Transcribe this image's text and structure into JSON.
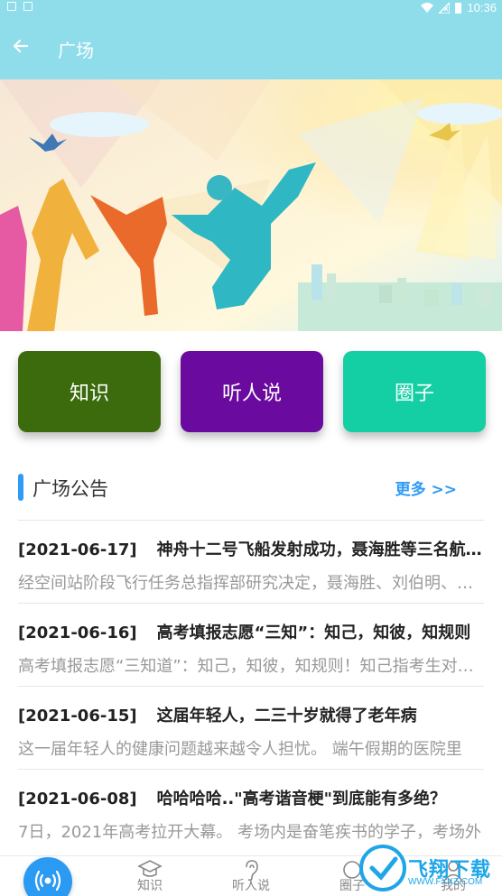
{
  "status_bar": {
    "time": "10:36"
  },
  "app_bar": {
    "title": "广场"
  },
  "categories": [
    {
      "label": "知识",
      "color": "#3b6b0d"
    },
    {
      "label": "听人说",
      "color": "#6a0a9f"
    },
    {
      "label": "圈子",
      "color": "#14cfa4"
    }
  ],
  "section": {
    "title": "广场公告",
    "more": "更多 >>"
  },
  "news": [
    {
      "date": "[2021-06-17]",
      "title": "神舟十二号飞船发射成功，聂海胜等三名航天员进入太空",
      "summary": "经空间站阶段飞行任务总指挥部研究决定，聂海胜、刘伯明、汤洪波三名航天员"
    },
    {
      "date": "[2021-06-16]",
      "title": "高考填报志愿“三知”：知己，知彼，知规则",
      "summary": "高考填报志愿“三知道”：知己，知彼，知规则！知己指考生对自己的了解"
    },
    {
      "date": "[2021-06-15]",
      "title": "这届年轻人，二三十岁就得了老年病",
      "summary": "这一届年轻人的健康问题越来越令人担忧。 端午假期的医院里"
    },
    {
      "date": "[2021-06-08]",
      "title": "哈哈哈哈..\"高考谐音梗\"到底能有多绝？",
      "summary": "7日，2021年高考拉开大幕。 考场内是奋笔疾书的学子，考场外"
    }
  ],
  "bottom_nav": [
    {
      "label": "知识",
      "icon": "graduation-cap-icon"
    },
    {
      "label": "听人说",
      "icon": "ear-icon"
    },
    {
      "label": "圈子",
      "icon": "circle-icon"
    },
    {
      "label": "我的",
      "icon": "user-icon"
    }
  ],
  "watermark": {
    "text": "飞翔下载",
    "url": "WWW.FXXZ.COM"
  }
}
